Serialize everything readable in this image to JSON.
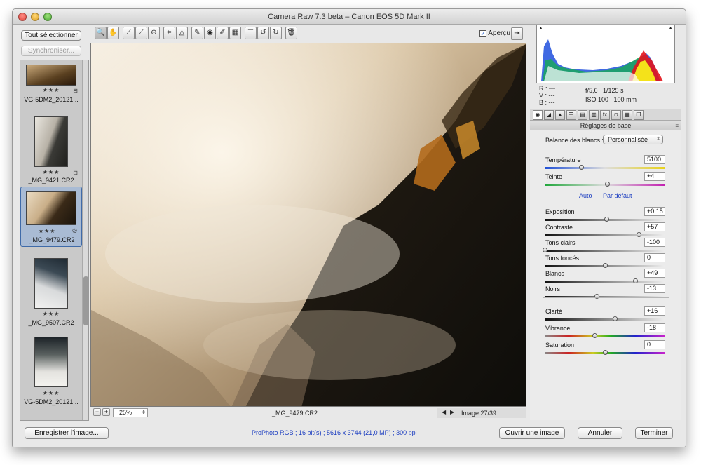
{
  "window": {
    "title": "Camera Raw 7.3 beta  –  Canon EOS 5D Mark II"
  },
  "filmstrip": {
    "select_all": "Tout sélectionner",
    "synchronize": "Synchroniser...",
    "items": [
      {
        "name": "VG-5DM2_20121...",
        "stars": "★★★",
        "selected": false
      },
      {
        "name": "_MG_9421.CR2",
        "stars": "★★★",
        "selected": false
      },
      {
        "name": "_MG_9479.CR2",
        "stars": "★★★ · ·",
        "selected": true
      },
      {
        "name": "_MG_9507.CR2",
        "stars": "★★★",
        "selected": false
      },
      {
        "name": "VG-5DM2_20121...",
        "stars": "★★★",
        "selected": false
      }
    ]
  },
  "toolbar": {
    "tools": [
      "zoom-icon",
      "hand-icon",
      "white-balance-icon",
      "color-sampler-icon",
      "target-adjust-icon",
      "crop-icon",
      "straighten-icon",
      "spot-removal-icon",
      "red-eye-icon",
      "adjustment-brush-icon",
      "graduated-filter-icon",
      "list-icon",
      "rotate-left-icon",
      "rotate-right-icon",
      "trash-icon"
    ],
    "tool_glyphs": [
      "🔍",
      "✋",
      "⟋",
      "⟋",
      "⊕",
      "⌗",
      "△",
      "✎",
      "◉",
      "✐",
      "▦",
      "☰",
      "↺",
      "↻",
      "🗑"
    ],
    "preview_label": "Aperçu",
    "preview_checked": true
  },
  "preview": {
    "filename": "_MG_9479.CR2",
    "zoom": "25%",
    "image_counter": "Image 27/39"
  },
  "camera_info": {
    "r": "R :",
    "v": "V :",
    "b": "B :",
    "dash": "---",
    "aperture": "f/5,6",
    "shutter": "1/125 s",
    "iso": "ISO 100",
    "focal": "100 mm"
  },
  "panel": {
    "title": "Réglages de base",
    "wb_label": "Balance des blancs :",
    "wb_value": "Personnalisée",
    "auto": "Auto",
    "default": "Par défaut",
    "sliders": [
      {
        "label": "Température",
        "value": "5100",
        "pos": 0.3,
        "track": "temp"
      },
      {
        "label": "Teinte",
        "value": "+4",
        "pos": 0.52,
        "track": "tint"
      },
      {
        "label": "Exposition",
        "value": "+0,15",
        "pos": 0.51,
        "track": "gray"
      },
      {
        "label": "Contraste",
        "value": "+57",
        "pos": 0.78,
        "track": "gray"
      },
      {
        "label": "Tons clairs",
        "value": "-100",
        "pos": 0.0,
        "track": "gray"
      },
      {
        "label": "Tons foncés",
        "value": "0",
        "pos": 0.5,
        "track": "gray"
      },
      {
        "label": "Blancs",
        "value": "+49",
        "pos": 0.75,
        "track": "gray"
      },
      {
        "label": "Noirs",
        "value": "-13",
        "pos": 0.43,
        "track": "gray"
      },
      {
        "label": "Clarté",
        "value": "+16",
        "pos": 0.58,
        "track": "gray"
      },
      {
        "label": "Vibrance",
        "value": "-18",
        "pos": 0.41,
        "track": "color"
      },
      {
        "label": "Saturation",
        "value": "0",
        "pos": 0.5,
        "track": "color"
      }
    ]
  },
  "footer": {
    "save": "Enregistrer l'image...",
    "workflow": "ProPhoto RGB ; 16 bit(s) ; 5616 x 3744 (21,0 MP) ; 300 ppi",
    "open": "Ouvrir une image",
    "cancel": "Annuler",
    "done": "Terminer"
  },
  "colors": {
    "accent": "#3f6aa8",
    "link": "#1a3cc0"
  }
}
